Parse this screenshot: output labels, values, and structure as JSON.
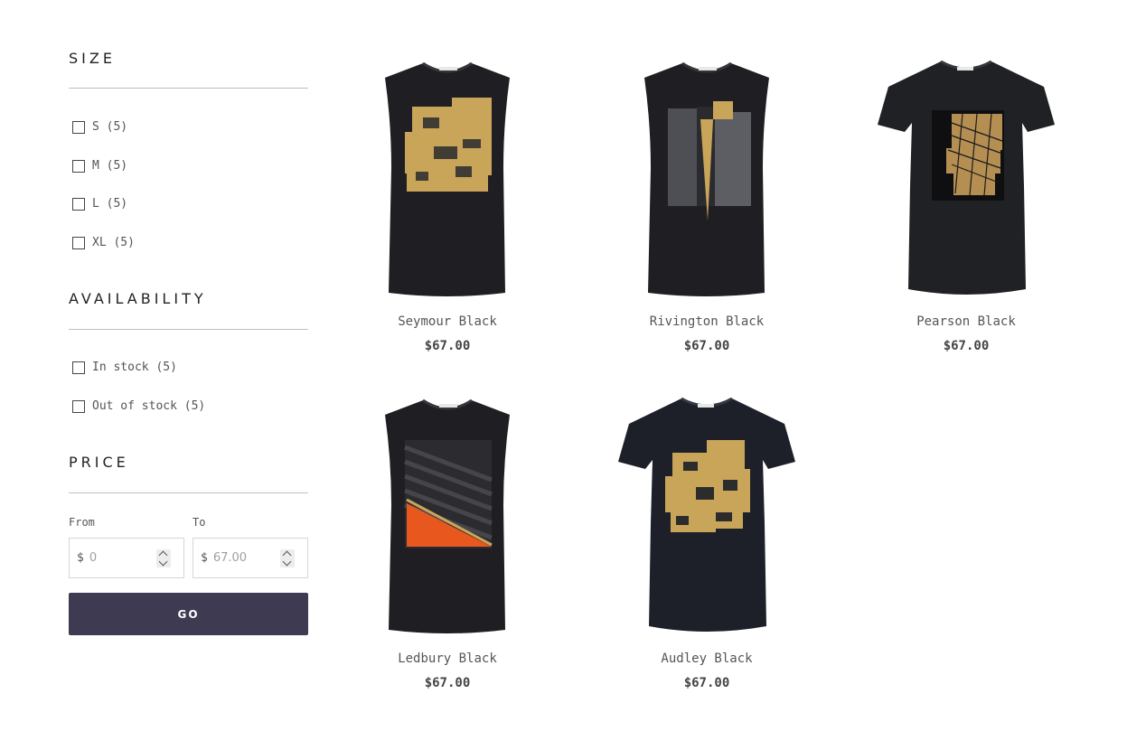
{
  "filters": {
    "size": {
      "title": "SIZE",
      "options": [
        "S (5)",
        "M (5)",
        "L (5)",
        "XL (5)"
      ]
    },
    "availability": {
      "title": "AVAILABILITY",
      "options": [
        "In stock (5)",
        "Out of stock (5)"
      ]
    },
    "price": {
      "title": "PRICE",
      "from_label": "From",
      "to_label": "To",
      "currency": "$",
      "from_placeholder": "0",
      "to_placeholder": "67.00",
      "go_label": "GO"
    }
  },
  "products": [
    {
      "name": "Seymour Black",
      "price": "$67.00"
    },
    {
      "name": "Rivington Black",
      "price": "$67.00"
    },
    {
      "name": "Pearson Black",
      "price": "$67.00"
    },
    {
      "name": "Ledbury Black",
      "price": "$67.00"
    },
    {
      "name": "Audley Black",
      "price": "$67.00"
    }
  ],
  "colors": {
    "button": "#3e3a52",
    "garment": "#1f1f23",
    "gold": "#c9a55a",
    "orange": "#e8571e"
  }
}
